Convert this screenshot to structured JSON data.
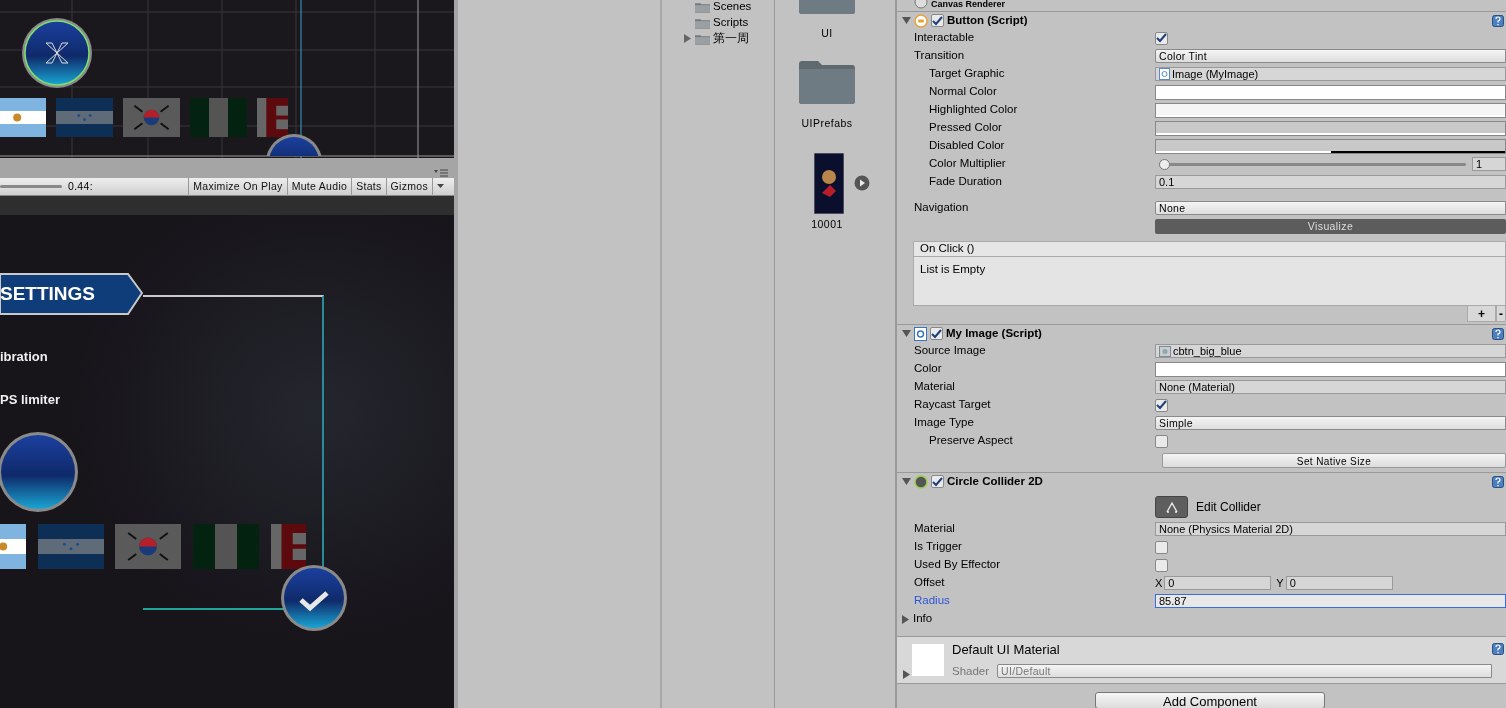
{
  "game_toolbar": {
    "scale_reading": "0.44:",
    "buttons": [
      {
        "label": "Maximize On Play",
        "kind": "plain"
      },
      {
        "label": "Mute Audio",
        "kind": "plain"
      },
      {
        "label": "Stats",
        "kind": "plain"
      },
      {
        "label": "Gizmos",
        "kind": "dropdown"
      }
    ]
  },
  "game_view": {
    "banner_title": "SETTINGS",
    "options": [
      "ibration",
      "PS limiter"
    ]
  },
  "project": {
    "tree": [
      {
        "name": "Scenes",
        "has_children": false
      },
      {
        "name": "Scripts",
        "has_children": false
      },
      {
        "name": "第一周",
        "has_children": true,
        "expanded": false
      }
    ],
    "assets": [
      {
        "name": "UI",
        "kind": "folder"
      },
      {
        "name": "UIPrefabs",
        "kind": "folder"
      },
      {
        "name": "10001",
        "kind": "sprite"
      }
    ]
  },
  "inspector": {
    "components": [
      {
        "title": "Canvas Renderer",
        "kind": "renderer"
      },
      {
        "title": "Button (Script)",
        "kind": "button",
        "enabled": true,
        "expanded": true,
        "rows": [
          {
            "kind": "checkbox",
            "label": "Interactable",
            "checked": true
          },
          {
            "kind": "dropdown",
            "label": "Transition",
            "value": "Color Tint",
            "children": [
              {
                "kind": "script_object",
                "label": "Target Graphic",
                "value": "Image (MyImage)"
              },
              {
                "kind": "color",
                "label": "Normal Color",
                "color": "#ffffff",
                "level": 1
              },
              {
                "kind": "color",
                "label": "Highlighted Color",
                "color": "#f5f5f5",
                "level": 1
              },
              {
                "kind": "color",
                "label": "Pressed Color",
                "color": "#c8c8c8",
                "level": 1
              },
              {
                "kind": "color",
                "label": "Disabled Color",
                "color": "#c8c8c8",
                "level": 0.5
              },
              {
                "kind": "slider",
                "label": "Color Multiplier",
                "level": 0,
                "value": "1"
              },
              {
                "kind": "text",
                "label": "Fade Duration",
                "value": "0.1",
                "focused": false
              }
            ]
          },
          {
            "kind": "dropdown",
            "label": "Navigation",
            "value": "None"
          },
          {
            "kind": "toggle",
            "label": "Visualize",
            "on": true
          },
          {
            "kind": "event",
            "title": "On Click ()",
            "body": "List is Empty",
            "add": "+",
            "remove": "-"
          }
        ]
      },
      {
        "title": "My Image (Script)",
        "kind": "script",
        "enabled": true,
        "expanded": true,
        "rows": [
          {
            "kind": "sprite_object",
            "label": "Source Image",
            "value": "cbtn_big_blue"
          },
          {
            "kind": "color",
            "label": "Color",
            "color": "#ffffff",
            "level": 1
          },
          {
            "kind": "object",
            "label": "Material",
            "value": "None (Material)"
          },
          {
            "kind": "checkbox",
            "label": "Raycast Target",
            "checked": true
          },
          {
            "kind": "dropdown",
            "label": "Image Type",
            "value": "Simple",
            "children": [
              {
                "kind": "checkbox",
                "label": "Preserve Aspect",
                "checked": false
              }
            ]
          },
          {
            "kind": "button",
            "label": "Set Native Size"
          }
        ]
      },
      {
        "title": "Circle Collider 2D",
        "kind": "collider",
        "enabled": true,
        "expanded": true,
        "rows": [
          {
            "kind": "edit_button",
            "label": "Edit Collider"
          },
          {
            "kind": "object",
            "label": "Material",
            "value": "None (Physics Material 2D)"
          },
          {
            "kind": "checkbox",
            "label": "Is Trigger",
            "checked": false
          },
          {
            "kind": "checkbox",
            "label": "Used By Effector",
            "checked": false
          },
          {
            "kind": "vector",
            "label": "Offset",
            "fields": [
              {
                "axis": "X",
                "value": "0"
              },
              {
                "axis": "Y",
                "value": "0"
              }
            ]
          },
          {
            "kind": "text",
            "label": "Radius",
            "value": "85.87",
            "focused": true
          },
          {
            "kind": "foldout",
            "label": "Info",
            "expanded": false
          }
        ]
      }
    ],
    "material": {
      "name": "Default UI Material",
      "shader_label": "Shader",
      "shader": "UI/Default",
      "expanded": false
    },
    "add_button": "Add Component"
  }
}
